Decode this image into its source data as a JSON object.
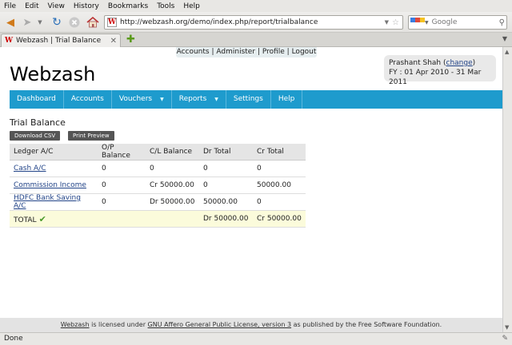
{
  "menu": [
    "File",
    "Edit",
    "View",
    "History",
    "Bookmarks",
    "Tools",
    "Help"
  ],
  "browser": {
    "url": "http://webzash.org/demo/index.php/report/trialbalance",
    "search_placeholder": "Google",
    "tab_title": "Webzash | Trial Balance",
    "status": "Done"
  },
  "page": {
    "top_links": [
      "Accounts",
      "Administer",
      "Profile",
      "Logout"
    ],
    "logo": "Webzash",
    "user": {
      "name": "Prashant Shah",
      "change_label": "change",
      "fy": "FY : 01 Apr 2010 - 31 Mar 2011"
    },
    "nav": [
      {
        "label": "Dashboard",
        "dropdown": false
      },
      {
        "label": "Accounts",
        "dropdown": false
      },
      {
        "label": "Vouchers",
        "dropdown": true
      },
      {
        "label": "Reports",
        "dropdown": true
      },
      {
        "label": "Settings",
        "dropdown": false
      },
      {
        "label": "Help",
        "dropdown": false
      }
    ],
    "title": "Trial Balance",
    "buttons": {
      "download": "Download CSV",
      "preview": "Print Preview"
    },
    "table": {
      "headers": [
        "Ledger A/C",
        "O/P Balance",
        "C/L Balance",
        "Dr Total",
        "Cr Total"
      ],
      "rows": [
        [
          "Cash A/C",
          "0",
          "0",
          "0",
          "0"
        ],
        [
          "Commission Income",
          "0",
          "Cr 50000.00",
          "0",
          "50000.00"
        ],
        [
          "HDFC Bank Saving A/C",
          "0",
          "Dr 50000.00",
          "50000.00",
          "0"
        ]
      ],
      "total": {
        "label": "TOTAL",
        "dr": "Dr 50000.00",
        "cr": "Cr 50000.00"
      }
    },
    "footer": {
      "link1": "Webzash",
      "text1": " is licensed under ",
      "link2": "GNU Affero General Public License, version 3",
      "text2": " as published by the Free Software Foundation."
    }
  }
}
